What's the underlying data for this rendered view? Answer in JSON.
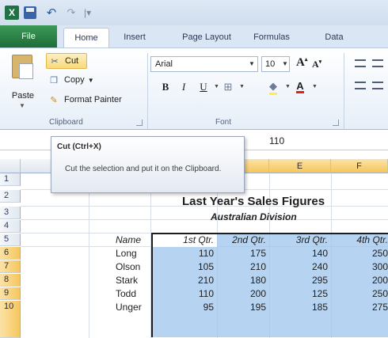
{
  "qat": {
    "logo": "X",
    "icons": [
      "excel-logo-icon",
      "save-icon",
      "undo-icon",
      "redo-icon",
      "customize-qat-icon"
    ]
  },
  "tabs": {
    "file": "File",
    "home": "Home",
    "insert": "Insert",
    "page_layout": "Page Layout",
    "formulas": "Formulas",
    "data": "Data"
  },
  "clipboard": {
    "paste": "Paste",
    "cut": "Cut",
    "copy": "Copy",
    "format_painter": "Format Painter",
    "group_label": "Clipboard"
  },
  "font": {
    "name": "Arial",
    "size": "10",
    "bold": "B",
    "italic": "I",
    "underline": "U",
    "grow": "A",
    "shrink": "A",
    "font_color": "A",
    "group_label": "Font"
  },
  "formula_bar": {
    "content": "110"
  },
  "columns": [
    "E",
    "F"
  ],
  "rows": [
    "1",
    "2",
    "3",
    "4",
    "5",
    "6",
    "7",
    "8",
    "9",
    "10"
  ],
  "sheet": {
    "title": "Last Year's Sales Figures",
    "subtitle": "Australian Division",
    "headers": {
      "name": "Name",
      "q1": "1st Qtr.",
      "q2": "2nd Qtr.",
      "q3": "3rd Qtr.",
      "q4": "4th Qtr."
    },
    "data": [
      {
        "name": "Long",
        "q1": "110",
        "q2": "175",
        "q3": "140",
        "q4": "250"
      },
      {
        "name": "Olson",
        "q1": "105",
        "q2": "210",
        "q3": "240",
        "q4": "300"
      },
      {
        "name": "Stark",
        "q1": "210",
        "q2": "180",
        "q3": "295",
        "q4": "200"
      },
      {
        "name": "Todd",
        "q1": "110",
        "q2": "200",
        "q3": "125",
        "q4": "250"
      },
      {
        "name": "Unger",
        "q1": "95",
        "q2": "195",
        "q3": "185",
        "q4": "275"
      }
    ]
  },
  "tooltip": {
    "title": "Cut (Ctrl+X)",
    "body": "Cut the selection and put it on the Clipboard."
  },
  "colors": {
    "file_tab": "#2d7a45",
    "selection": "#9ec5ec",
    "header_highlight": "#f5c65e",
    "cut_highlight": "#f9d97c"
  }
}
